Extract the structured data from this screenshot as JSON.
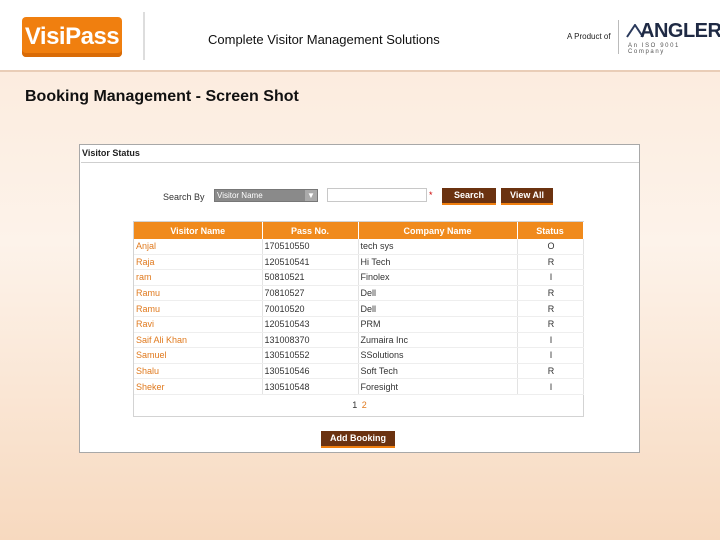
{
  "header": {
    "logo_text": "VisiPass",
    "tagline": "Complete Visitor Management Solutions",
    "product_of": "A Product of",
    "company_name": "ANGLER",
    "company_sub": "An ISO 9001 Company"
  },
  "page_heading": "Booking Management - Screen Shot",
  "panel": {
    "title": "Visitor Status",
    "search_label": "Search By",
    "search_select_value": "Visitor Name",
    "search_input_value": "",
    "required_mark": "*",
    "search_button": "Search",
    "view_all_button": "View All",
    "add_booking_button": "Add Booking"
  },
  "table": {
    "columns": [
      "Visitor Name",
      "Pass No.",
      "Company Name",
      "Status"
    ],
    "rows": [
      {
        "name": "Anjal",
        "pass": "170510550",
        "company": "tech sys",
        "status": "O"
      },
      {
        "name": "Raja",
        "pass": "120510541",
        "company": "Hi Tech",
        "status": "R"
      },
      {
        "name": "ram",
        "pass": "50810521",
        "company": "Finolex",
        "status": "I"
      },
      {
        "name": "Ramu",
        "pass": "70810527",
        "company": "Dell",
        "status": "R"
      },
      {
        "name": "Ramu",
        "pass": "70010520",
        "company": "Dell",
        "status": "R"
      },
      {
        "name": "Ravi",
        "pass": "120510543",
        "company": "PRM",
        "status": "R"
      },
      {
        "name": "Saif Ali Khan",
        "pass": "131008370",
        "company": "Zumaira Inc",
        "status": "I"
      },
      {
        "name": "Samuel",
        "pass": "130510552",
        "company": "SSolutions",
        "status": "I"
      },
      {
        "name": "Shalu",
        "pass": "130510546",
        "company": "Soft Tech",
        "status": "R"
      },
      {
        "name": "Sheker",
        "pass": "130510548",
        "company": "Foresight",
        "status": "I"
      }
    ]
  },
  "pager": {
    "current": "1",
    "other": "2"
  },
  "colors": {
    "accent": "#f08a1c",
    "button": "#6b3210",
    "link": "#e07a1e"
  }
}
